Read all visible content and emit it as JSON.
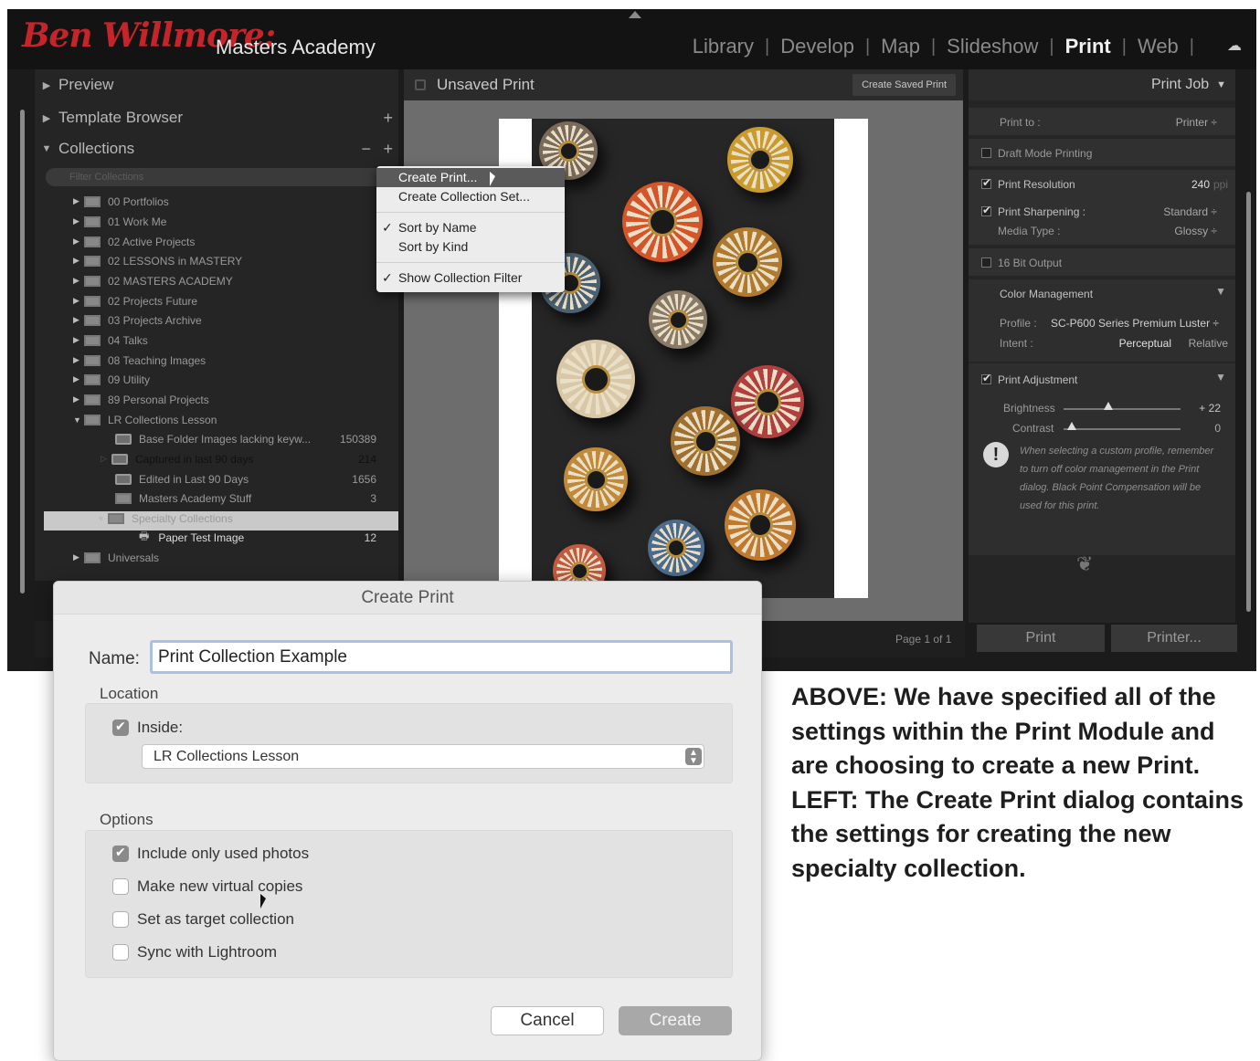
{
  "app": {
    "brand_script": "Ben Willmore:",
    "brand_text": "Masters Academy",
    "modules": [
      "Library",
      "Develop",
      "Map",
      "Slideshow",
      "Print",
      "Web"
    ],
    "active_module": "Print"
  },
  "left_panel": {
    "preview_label": "Preview",
    "template_browser_label": "Template Browser",
    "collections_label": "Collections",
    "filter_placeholder": "Filter Collections",
    "collections": [
      {
        "label": "00 Portfolios",
        "count": ""
      },
      {
        "label": "01 Work Me",
        "count": ""
      },
      {
        "label": "02 Active Projects",
        "count": ""
      },
      {
        "label": "02 LESSONS in MASTERY",
        "count": ""
      },
      {
        "label": "02 MASTERS ACADEMY",
        "count": ""
      },
      {
        "label": "02 Projects Future",
        "count": ""
      },
      {
        "label": "03 Projects Archive",
        "count": ""
      },
      {
        "label": "04 Talks",
        "count": ""
      },
      {
        "label": "08 Teaching Images",
        "count": ""
      },
      {
        "label": "09 Utility",
        "count": ""
      },
      {
        "label": "89 Personal Projects",
        "count": ""
      },
      {
        "label": "LR Collections Lesson",
        "count": ""
      },
      {
        "label": "Base Folder Images lacking keyw...",
        "count": "150389"
      },
      {
        "label": "Captured in last 90 days",
        "count": "214"
      },
      {
        "label": "Edited in Last 90 Days",
        "count": "1656"
      },
      {
        "label": "Masters Academy Stuff",
        "count": "3"
      },
      {
        "label": "Specialty Collections",
        "count": ""
      },
      {
        "label": "Paper Test Image",
        "count": "12"
      },
      {
        "label": "Universals",
        "count": ""
      }
    ]
  },
  "context_menu": {
    "items": [
      "Create Print...",
      "Create Collection Set...",
      "Sort by Name",
      "Sort by Kind",
      "Show Collection Filter"
    ]
  },
  "center": {
    "title": "Unsaved Print",
    "create_saved_label": "Create Saved Print",
    "page_indicator": "Page 1 of 1"
  },
  "right_panel": {
    "header": "Print Job",
    "print_to_label": "Print to :",
    "print_to_value": "Printer",
    "draft_label": "Draft Mode Printing",
    "resolution_label": "Print Resolution",
    "resolution_value": "240",
    "resolution_unit": "ppi",
    "sharpening_label": "Print Sharpening :",
    "sharpening_value": "Standard",
    "media_label": "Media Type :",
    "media_value": "Glossy",
    "bit_label": "16 Bit Output",
    "color_mgmt_label": "Color Management",
    "profile_label": "Profile :",
    "profile_value": "SC-P600 Series Premium Luster",
    "intent_label": "Intent :",
    "intent_perceptual": "Perceptual",
    "intent_relative": "Relative",
    "adjust_label": "Print Adjustment",
    "brightness_label": "Brightness",
    "brightness_value": "+ 22",
    "contrast_label": "Contrast",
    "contrast_value": "0",
    "warning_text": "When selecting a custom profile, remember to turn off color management in the Print dialog. Black Point Compensation will be used for this print.",
    "print_button": "Print",
    "printer_button": "Printer..."
  },
  "dialog": {
    "title": "Create Print",
    "name_label": "Name:",
    "name_value": "Print Collection Example",
    "location_label": "Location",
    "inside_label": "Inside:",
    "inside_value": "LR Collections Lesson",
    "options_label": "Options",
    "opt_used": "Include only used photos",
    "opt_virtual": "Make new virtual copies",
    "opt_target": "Set as target collection",
    "opt_sync": "Sync with Lightroom",
    "cancel_label": "Cancel",
    "create_label": "Create"
  },
  "caption": {
    "line1": "ABOVE: We have specified all of the settings within the Print Module and are choosing to create a new Print.",
    "line2": "LEFT: The Create Print dialog contains the settings for creating the new specialty collection."
  },
  "colors": {
    "brand_red": "#c6242b",
    "menu_highlight": "#5a5a5a"
  }
}
